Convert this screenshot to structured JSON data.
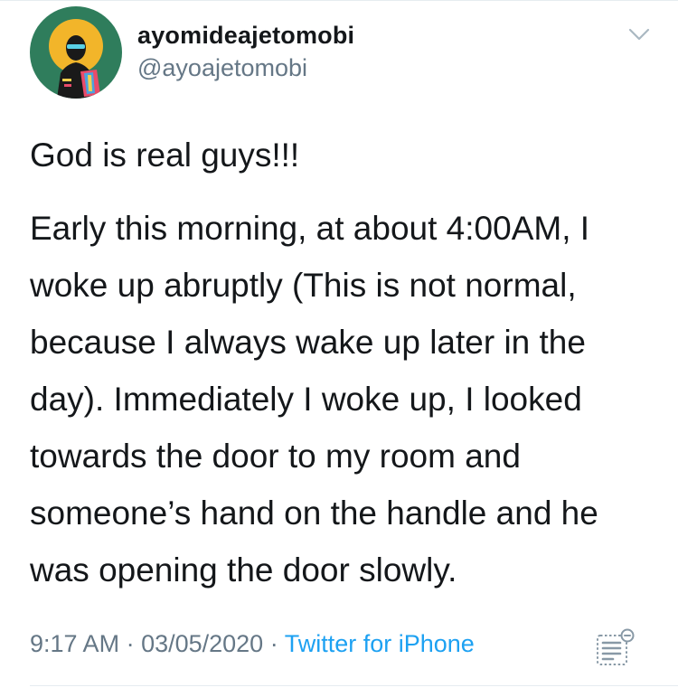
{
  "tweet": {
    "author": {
      "display_name": "ayomideajetomobi",
      "handle": "@ayoajetomobi"
    },
    "text": {
      "paragraph_1": "God is real guys!!!",
      "paragraph_2_lines": [
        "Early this morning, at about 4:00AM, I",
        "woke up abruptly (This is not normal,",
        "because I always wake up later in the",
        "day). Immediately I woke up, I looked",
        "towards the door to my room and",
        "someone’s hand on the handle and he",
        "was opening the door slowly."
      ]
    },
    "meta": {
      "time": "9:17 AM",
      "separator_1": " · ",
      "date": "03/05/2020",
      "separator_2": " · ",
      "source": "Twitter for iPhone"
    }
  },
  "icons": {
    "menu": "chevron-down-icon",
    "analytics": "analytics-icon"
  },
  "colors": {
    "text_primary": "#14171a",
    "text_secondary": "#657786",
    "link": "#1da1f2",
    "divider": "#e6ecf0",
    "avatar_bg": "#2f7d5c",
    "avatar_ring": "#f2b52a"
  }
}
